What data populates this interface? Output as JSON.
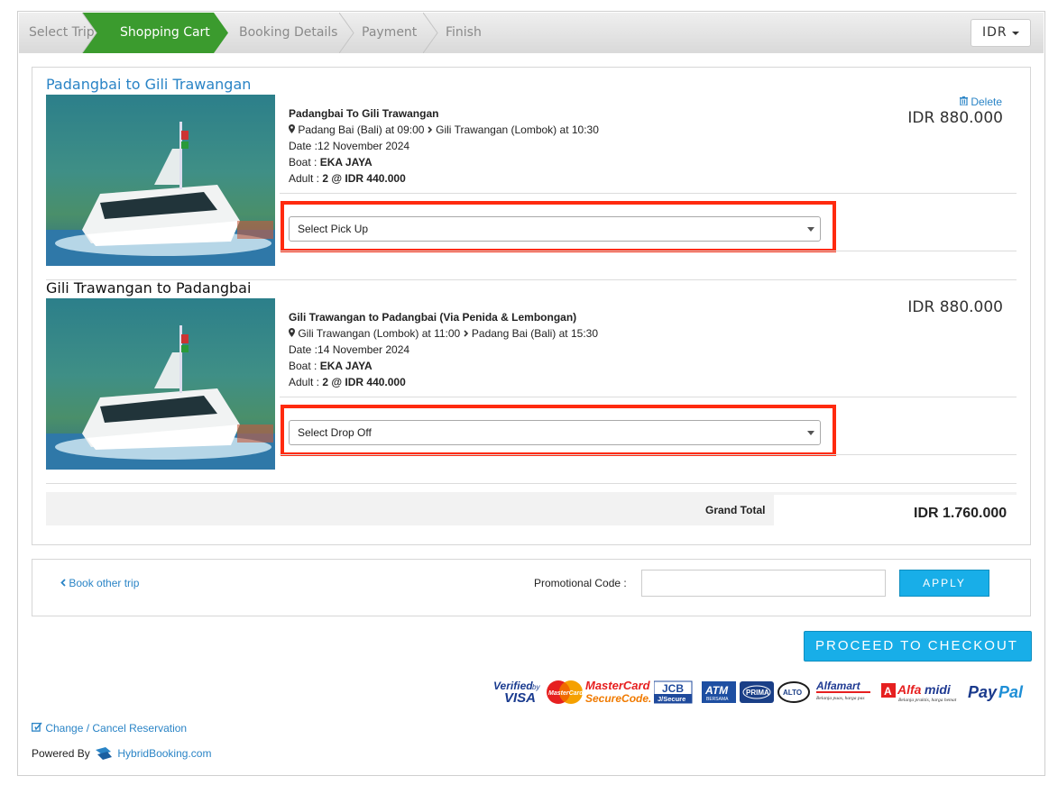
{
  "steps": {
    "select_trip": "Select Trip",
    "shopping_cart": "Shopping Cart",
    "booking_details": "Booking Details",
    "payment": "Payment",
    "finish": "Finish"
  },
  "currency": {
    "selected": "IDR"
  },
  "trips": [
    {
      "title": "Padangbai to Gili Trawangan",
      "header": "Padangbai To Gili Trawangan",
      "route_from": "Padang Bai (Bali) at 09:00",
      "route_to": "Gili Trawangan (Lombok) at 10:30",
      "date": "Date :12 November 2024",
      "boat_label": "Boat : ",
      "boat_name": "EKA JAYA",
      "adult_label": "Adult : ",
      "adult_value": "2 @ IDR 440.000",
      "price": "IDR 880.000",
      "delete": "Delete",
      "select_placeholder": "Select Pick Up"
    },
    {
      "title": "Gili Trawangan to Padangbai",
      "header": "Gili Trawangan to Padangbai (Via Penida & Lembongan)",
      "route_from": "Gili Trawangan (Lombok) at 11:00",
      "route_to": "Padang Bai (Bali) at 15:30",
      "date": "Date :14 November 2024",
      "boat_label": "Boat : ",
      "boat_name": "EKA JAYA",
      "adult_label": "Adult : ",
      "adult_value": "2 @ IDR 440.000",
      "price": "IDR 880.000",
      "select_placeholder": "Select Drop Off"
    }
  ],
  "total": {
    "label": "Grand Total",
    "value": "IDR 1.760.000"
  },
  "promo": {
    "book_other": "Book other trip",
    "label": "Promotional Code :",
    "input_value": "",
    "apply": "APPLY"
  },
  "checkout": {
    "label": "PROCEED TO CHECKOUT"
  },
  "payment_logos": [
    "Verified by VISA",
    "MasterCard SecureCode",
    "JCB J/Secure",
    "ATM Bersama",
    "PRIMA",
    "ALTO",
    "Alfamart",
    "Alfamidi",
    "PayPal"
  ],
  "footer": {
    "change_cancel": "Change / Cancel Reservation",
    "powered_by": "Powered By",
    "brand": "HybridBooking.com"
  },
  "colors": {
    "accent": "#18aee8",
    "active_step": "#3b9b2e",
    "highlight": "#ff2a0f",
    "link": "#2a84c6"
  }
}
